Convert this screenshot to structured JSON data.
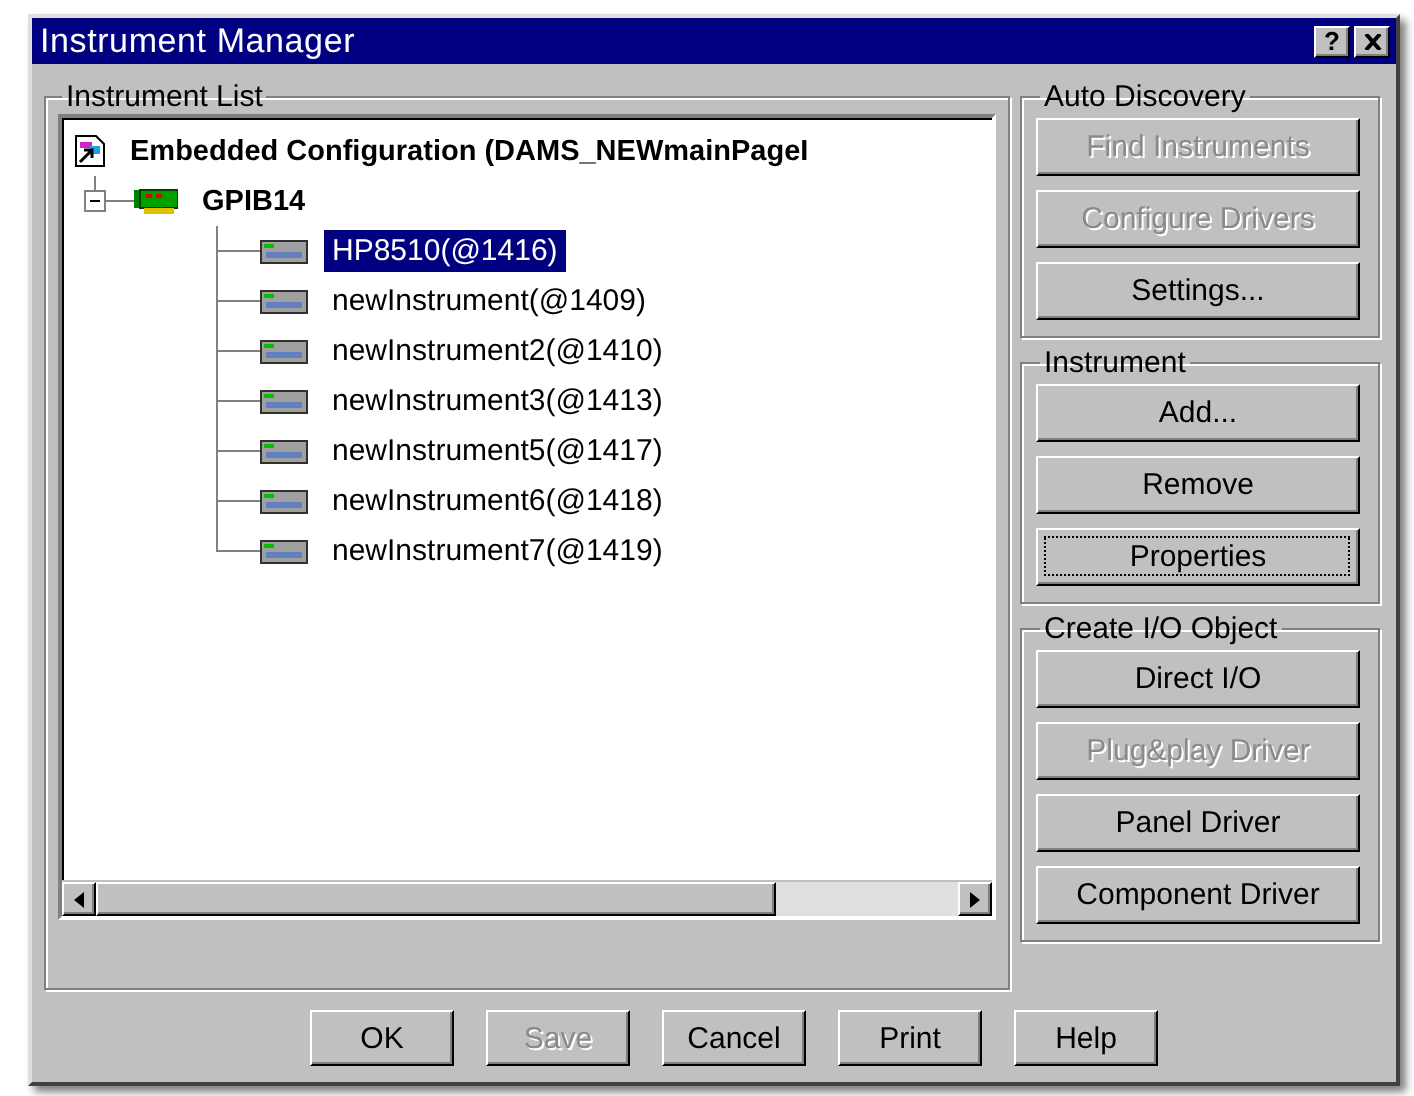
{
  "window": {
    "title": "Instrument Manager",
    "help_button": "?"
  },
  "instrument_list": {
    "title": "Instrument List",
    "tree": {
      "label": "Embedded Configuration (DAMS_NEWmainPageI",
      "kind": "configuration",
      "children": [
        {
          "label": "GPIB14",
          "kind": "bus",
          "expanded": true,
          "children": [
            {
              "label": "HP8510(@1416)",
              "kind": "instrument",
              "selected": true
            },
            {
              "label": "newInstrument(@1409)",
              "kind": "instrument",
              "selected": false
            },
            {
              "label": "newInstrument2(@1410)",
              "kind": "instrument",
              "selected": false
            },
            {
              "label": "newInstrument3(@1413)",
              "kind": "instrument",
              "selected": false
            },
            {
              "label": "newInstrument5(@1417)",
              "kind": "instrument",
              "selected": false
            },
            {
              "label": "newInstrument6(@1418)",
              "kind": "instrument",
              "selected": false
            },
            {
              "label": "newInstrument7(@1419)",
              "kind": "instrument",
              "selected": false
            }
          ]
        }
      ]
    }
  },
  "groups": [
    {
      "title": "Auto Discovery",
      "buttons": [
        {
          "label": "Find Instruments",
          "disabled": true,
          "focused": false
        },
        {
          "label": "Configure Drivers",
          "disabled": true,
          "focused": false
        },
        {
          "label": "Settings...",
          "disabled": false,
          "focused": false
        }
      ]
    },
    {
      "title": "Instrument",
      "buttons": [
        {
          "label": "Add...",
          "disabled": false,
          "focused": false
        },
        {
          "label": "Remove",
          "disabled": false,
          "focused": false
        },
        {
          "label": "Properties",
          "disabled": false,
          "focused": true
        }
      ]
    },
    {
      "title": "Create I/O Object",
      "buttons": [
        {
          "label": "Direct I/O",
          "disabled": false,
          "focused": false
        },
        {
          "label": "Plug&play Driver",
          "disabled": true,
          "focused": false
        },
        {
          "label": "Panel Driver",
          "disabled": false,
          "focused": false
        },
        {
          "label": "Component Driver",
          "disabled": false,
          "focused": false
        }
      ]
    }
  ],
  "footer_buttons": [
    {
      "label": "OK",
      "disabled": false
    },
    {
      "label": "Save",
      "disabled": true
    },
    {
      "label": "Cancel",
      "disabled": false
    },
    {
      "label": "Print",
      "disabled": false
    },
    {
      "label": "Help",
      "disabled": false
    }
  ]
}
